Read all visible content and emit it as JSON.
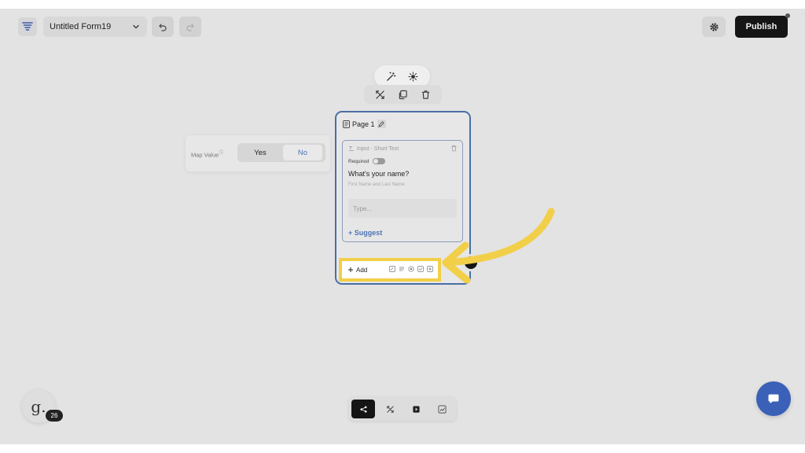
{
  "header": {
    "form_name": "Untitled Form19",
    "publish_label": "Publish"
  },
  "map_value": {
    "label": "Map Value",
    "yes_label": "Yes",
    "no_label": "No"
  },
  "page": {
    "title": "Page 1",
    "question": {
      "type_label": "Input - Short Text",
      "required_label": "Required",
      "title": "What's your name?",
      "subtitle": "First Name and Last Name",
      "placeholder": "Type...",
      "suggest_label": "+ Suggest"
    },
    "add_label": "Add"
  },
  "user": {
    "avatar_letter": "g.",
    "badge_count": "26"
  },
  "colors": {
    "accent_blue": "#4c74b6",
    "highlight_yellow": "#f2cf48",
    "chat_blue": "#3a60b8"
  }
}
